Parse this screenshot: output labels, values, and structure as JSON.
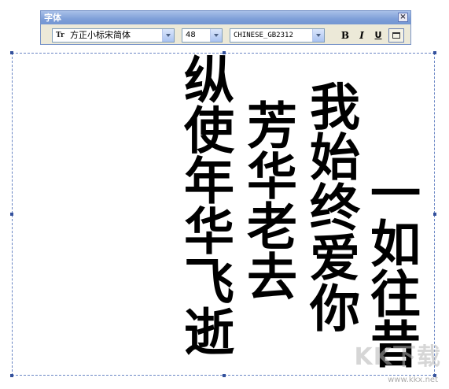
{
  "window": {
    "title": "字体",
    "close_glyph": "×"
  },
  "toolbar": {
    "font_icon": "Tr",
    "font_name": "方正小标宋简体",
    "font_size": "48",
    "charset": "CHINESE_GB2312",
    "bold_label": "B",
    "italic_label": "I",
    "underline_label": "U",
    "vertical_text_active": true
  },
  "document": {
    "columns": [
      "一如往昔",
      "我始终爱你",
      "芳华老去",
      "纵使年华飞逝"
    ]
  },
  "watermark": {
    "text": "KK下载",
    "url": "www.kkx.net"
  }
}
